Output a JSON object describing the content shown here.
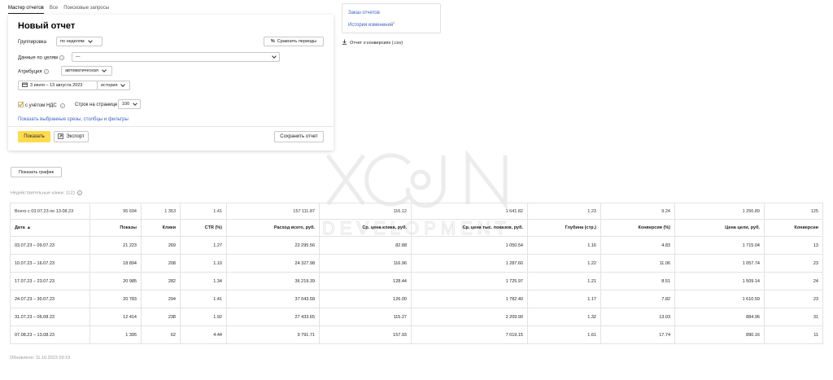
{
  "tabs": [
    "Мастер отчетов",
    "Все",
    "Поисковые запросы"
  ],
  "report": {
    "title": "Новый отчет",
    "grouping_label": "Группировка",
    "grouping_value": "по неделям",
    "compare_label": "Сравнить периоды",
    "goals_label": "Данные по целям",
    "goals_value": "—",
    "attribution_label": "Атрибуция",
    "attribution_value": "автоматическая",
    "date_range": "3 июля – 13 августа 2023",
    "history_value": "история",
    "vat_label": "с учётом НДС",
    "rows_label": "Строк на странице",
    "rows_value": "100",
    "selected_link": "Показать выбранные срезы, столбцы и фильтры",
    "show_button": "Показать",
    "export_button": "Экспорт",
    "save_button": "Сохранить отчет"
  },
  "side": {
    "order_reports": "Заказ отчетов",
    "history_changes": "История изменений",
    "history_badge": "1",
    "csv_link": "Отчет о конверсиях (.csv)"
  },
  "chart_button": "Показать график",
  "invalid_clicks": "Недействительные клики: 1121",
  "table": {
    "totals": [
      "Всего с 03.07.23 по 13.08.23",
      "95 694",
      "1 353",
      "1.41",
      "157 111.87",
      "116.12",
      "1 641.82",
      "1.23",
      "9.24",
      "1 256.89",
      "125"
    ],
    "headers": [
      "Дата",
      "Показы",
      "Клики",
      "CTR (%)",
      "Расход всего, руб.",
      "Ср. цена клика, руб.",
      "Ср. цена тыс. показов, руб.",
      "Глубина (стр.)",
      "Конверсия (%)",
      "Цена цели, руб.",
      "Конверсии"
    ],
    "sort_indicator": "▲",
    "rows": [
      [
        "03.07.23 – 09.07.23",
        "21 223",
        "269",
        "1.27",
        "22 295.56",
        "82.88",
        "1 050.54",
        "1.16",
        "4.83",
        "1 715.04",
        "13"
      ],
      [
        "10.07.23 – 16.07.23",
        "18 894",
        "208",
        "1.10",
        "24 327.98",
        "116.96",
        "1 287.60",
        "1.22",
        "11.06",
        "1 057.74",
        "23"
      ],
      [
        "17.07.23 – 23.07.23",
        "20 985",
        "282",
        "1.34",
        "36 219.39",
        "128.44",
        "1 725.97",
        "1.21",
        "8.51",
        "1 509.14",
        "24"
      ],
      [
        "24.07.23 – 30.07.23",
        "20 783",
        "294",
        "1.41",
        "37 043.58",
        "126.00",
        "1 782.40",
        "1.17",
        "7.82",
        "1 610.59",
        "23"
      ],
      [
        "31.07.23 – 06.08.23",
        "12 414",
        "238",
        "1.92",
        "27 433.65",
        "115.27",
        "2 209.90",
        "1.32",
        "13.03",
        "884.96",
        "31"
      ],
      [
        "07.08.23 – 13.08.23",
        "1 395",
        "62",
        "4.44",
        "9 791.71",
        "157.93",
        "7 019.15",
        "1.61",
        "17.74",
        "890.16",
        "11"
      ]
    ]
  },
  "updated": "Обновлено: 11.10.2023 09:19",
  "watermark_text": "DEVELOPMENT"
}
